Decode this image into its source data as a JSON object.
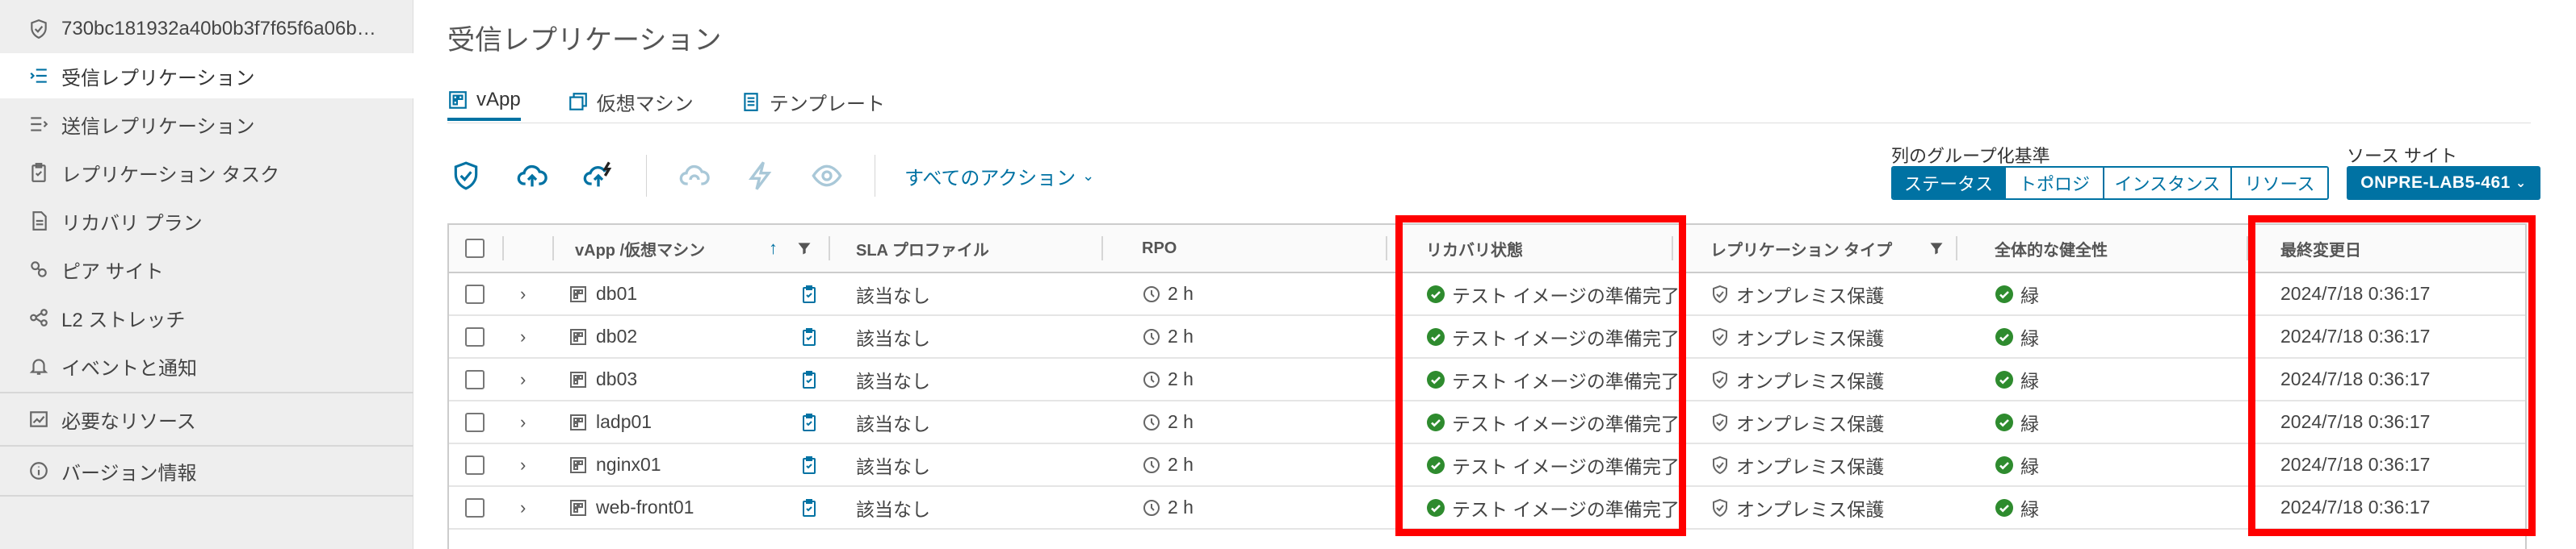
{
  "sidebar": {
    "items": [
      {
        "label": "730bc181932a40b0b3f7f65f6a06b…",
        "icon": "shield-check-icon"
      },
      {
        "label": "受信レプリケーション",
        "icon": "incoming-list-icon",
        "active": true
      },
      {
        "label": "送信レプリケーション",
        "icon": "outgoing-list-icon"
      },
      {
        "label": "レプリケーション タスク",
        "icon": "clipboard-icon"
      },
      {
        "label": "リカバリ プラン",
        "icon": "document-icon"
      },
      {
        "label": "ピア サイト",
        "icon": "peer-site-icon"
      },
      {
        "label": "L2 ストレッチ",
        "icon": "network-icon"
      },
      {
        "label": "イベントと通知",
        "icon": "bell-icon"
      },
      {
        "label": "必要なリソース",
        "icon": "chart-icon"
      },
      {
        "label": "バージョン情報",
        "icon": "info-icon"
      }
    ]
  },
  "page": {
    "title": "受信レプリケーション"
  },
  "tabs": [
    {
      "label": "vApp",
      "icon": "vapp-icon",
      "active": true
    },
    {
      "label": "仮想マシン",
      "icon": "vm-icon"
    },
    {
      "label": "テンプレート",
      "icon": "template-icon"
    }
  ],
  "toolbar": {
    "all_actions": "すべてのアクション",
    "icons": [
      "shield-check-icon",
      "cloud-upload-icon",
      "cloud-upload-bolt-icon",
      "cloud-sync-icon",
      "bolt-icon",
      "eye-icon"
    ]
  },
  "group_by": {
    "label": "列のグループ化基準",
    "options": [
      "ステータス",
      "トポロジ",
      "インスタンス",
      "リソース"
    ],
    "selected": "ステータス"
  },
  "source_site": {
    "label": "ソース サイト",
    "value": "ONPRE-LAB5-461"
  },
  "grid": {
    "columns": {
      "name": "vApp /仮想マシン",
      "sla": "SLA プロファイル",
      "rpo": "RPO",
      "recovery": "リカバリ状態",
      "replication_type": "レプリケーション タイプ",
      "health": "全体的な健全性",
      "last_modified": "最終変更日"
    },
    "rows": [
      {
        "name": "db01",
        "sla": "該当なし",
        "rpo": "2 h",
        "recovery": "テスト イメージの準備完了",
        "replication_type": "オンプレミス保護",
        "health": "緑",
        "last_modified": "2024/7/18 0:36:17"
      },
      {
        "name": "db02",
        "sla": "該当なし",
        "rpo": "2 h",
        "recovery": "テスト イメージの準備完了",
        "replication_type": "オンプレミス保護",
        "health": "緑",
        "last_modified": "2024/7/18 0:36:17"
      },
      {
        "name": "db03",
        "sla": "該当なし",
        "rpo": "2 h",
        "recovery": "テスト イメージの準備完了",
        "replication_type": "オンプレミス保護",
        "health": "緑",
        "last_modified": "2024/7/18 0:36:17"
      },
      {
        "name": "ladp01",
        "sla": "該当なし",
        "rpo": "2 h",
        "recovery": "テスト イメージの準備完了",
        "replication_type": "オンプレミス保護",
        "health": "緑",
        "last_modified": "2024/7/18 0:36:17"
      },
      {
        "name": "nginx01",
        "sla": "該当なし",
        "rpo": "2 h",
        "recovery": "テスト イメージの準備完了",
        "replication_type": "オンプレミス保護",
        "health": "緑",
        "last_modified": "2024/7/18 0:36:17"
      },
      {
        "name": "web-front01",
        "sla": "該当なし",
        "rpo": "2 h",
        "recovery": "テスト イメージの準備完了",
        "replication_type": "オンプレミス保護",
        "health": "緑",
        "last_modified": "2024/7/18 0:36:17"
      }
    ]
  },
  "colors": {
    "accent": "#0072a3",
    "ok": "#2e8b2e",
    "highlight": "#ff0000"
  }
}
